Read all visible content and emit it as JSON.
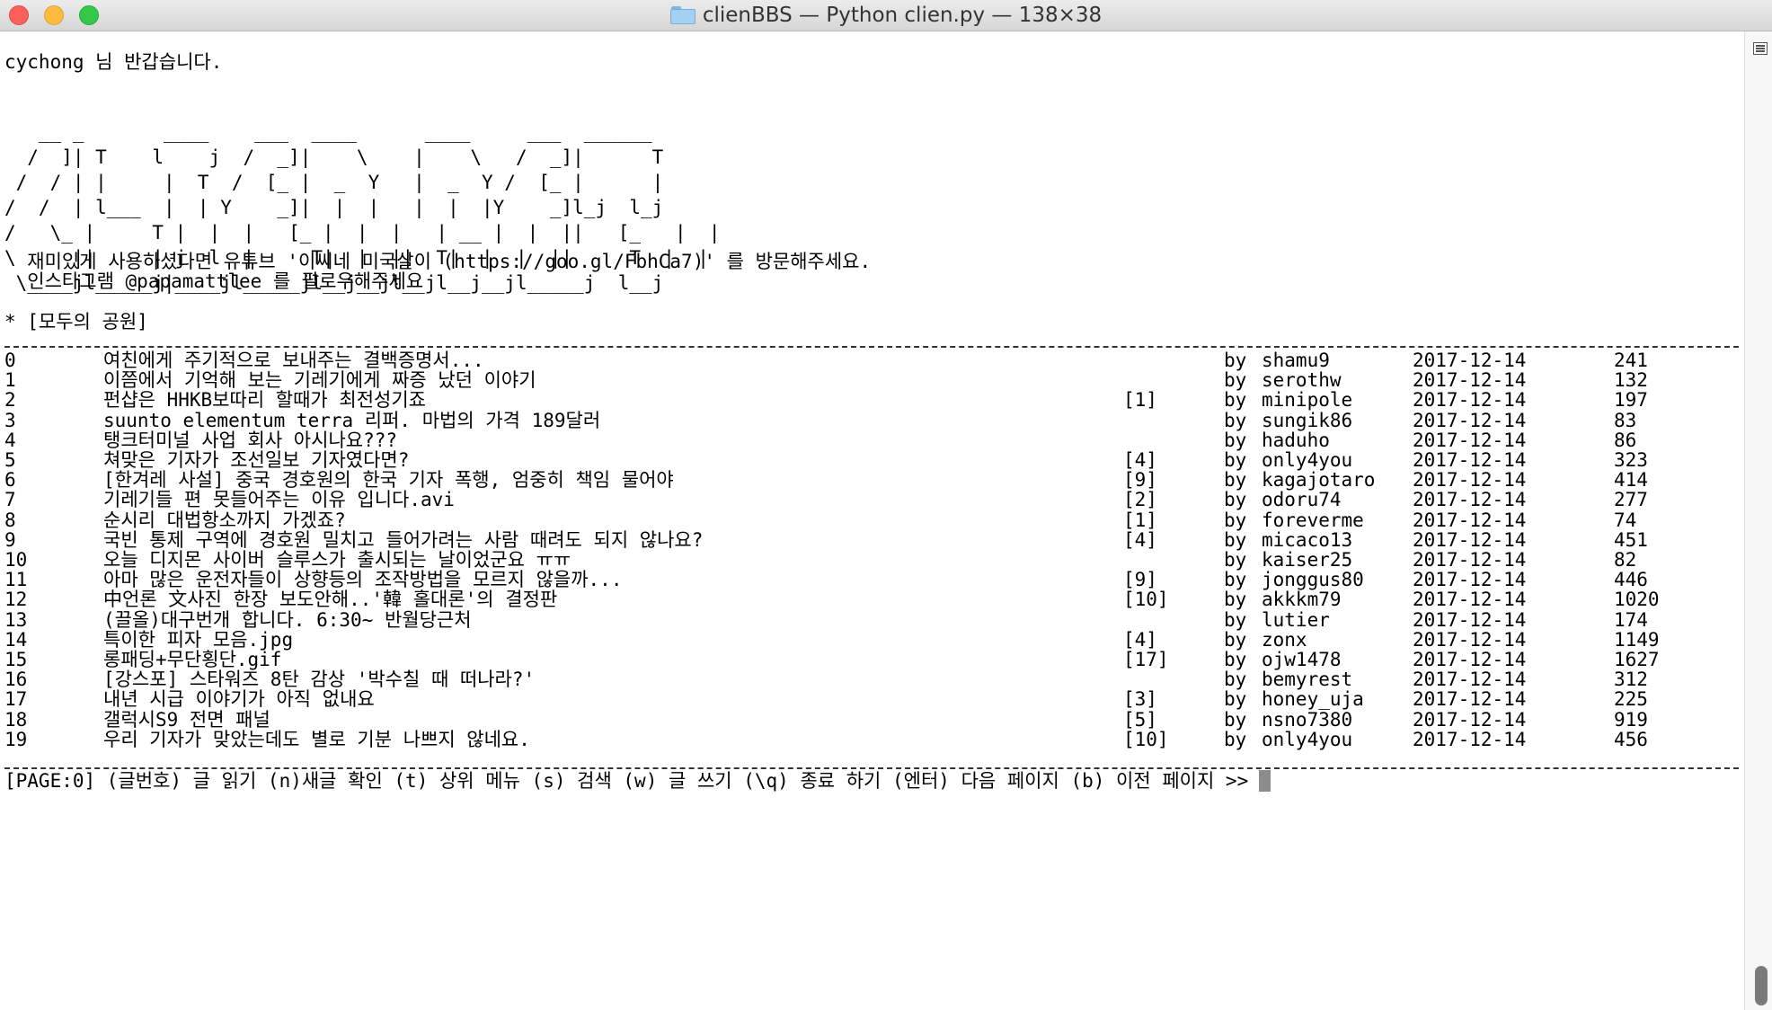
{
  "window": {
    "title": "clienBBS — Python clien.py — 138×38",
    "folder_icon": "folder-icon"
  },
  "greeting": "cychong 님 반갑습니다.",
  "ascii_art": "   __ _       ____    ___  ____      ____     ___  ______ \n  /  ]| T    l    j  /  _]|    \\    |    \\   /  _]|      T\n /  / | |     |  T  /  [_ |  _  Y   |  _  Y /  [_ |      |\n/  /  | l___  |  | Y    _]|  |  |   |  |  |Y    _]l_j  l_j\n/   \\_ |     T |  |  |   [_ |  |  |   | __ |  |  ||   [_   |  |  \n\\     ||     | j  l  |     T|  |  ||  T|  |  |  ||     T  |  |  \n \\____jl_____j|____jl_____jl__j__jl__jl__j__jl_____j  l__j",
  "promo": {
    "line1": "  재미있게 사용하셨다면 유튜브 '이씨네 미국살이 (https://goo.gl/FbhCa7)' 를 방문해주세요.",
    "line2": "  인스타그램 @papamattlee 를 팔로우해주세요"
  },
  "board_name": "* [모두의 공원]",
  "posts": [
    {
      "num": "0",
      "title": "여친에게 주기적으로 보내주는 결백증명서...",
      "comments": "",
      "by": "by",
      "author": "shamu9",
      "date": "2017-12-14",
      "views": "241"
    },
    {
      "num": "1",
      "title": "이쯤에서 기억해 보는 기레기에게 짜증 났던 이야기",
      "comments": "",
      "by": "by",
      "author": "serothw",
      "date": "2017-12-14",
      "views": "132"
    },
    {
      "num": "2",
      "title": "펀샵은 HHKB보따리 할때가 최전성기죠",
      "comments": "[1]",
      "by": "by",
      "author": "minipole",
      "date": "2017-12-14",
      "views": "197"
    },
    {
      "num": "3",
      "title": "suunto elementum terra 리퍼. 마법의 가격 189달러",
      "comments": "",
      "by": "by",
      "author": "sungik86",
      "date": "2017-12-14",
      "views": "83"
    },
    {
      "num": "4",
      "title": "탱크터미널 사업 회사 아시나요???",
      "comments": "",
      "by": "by",
      "author": "haduho",
      "date": "2017-12-14",
      "views": "86"
    },
    {
      "num": "5",
      "title": "쳐맞은 기자가 조선일보 기자였다면?",
      "comments": "[4]",
      "by": "by",
      "author": "only4you",
      "date": "2017-12-14",
      "views": "323"
    },
    {
      "num": "6",
      "title": "[한겨레 사설] 중국 경호원의 한국 기자 폭행, 엄중히 책임 물어야",
      "comments": "[9]",
      "by": "by",
      "author": "kagajotaro",
      "date": "2017-12-14",
      "views": "414"
    },
    {
      "num": "7",
      "title": "기레기들 편 못들어주는 이유 입니다.avi",
      "comments": "[2]",
      "by": "by",
      "author": "odoru74",
      "date": "2017-12-14",
      "views": "277"
    },
    {
      "num": "8",
      "title": "순시리 대법항소까지 가겠죠?",
      "comments": "[1]",
      "by": "by",
      "author": "foreverme",
      "date": "2017-12-14",
      "views": "74"
    },
    {
      "num": "9",
      "title": "국빈 통제 구역에 경호원 밀치고 들어가려는 사람 때려도 되지 않나요?",
      "comments": "[4]",
      "by": "by",
      "author": "micaco13",
      "date": "2017-12-14",
      "views": "451"
    },
    {
      "num": "10",
      "title": "오늘 디지몬 사이버 슬루스가 출시되는 날이었군요 ㅠㅠ",
      "comments": "",
      "by": "by",
      "author": "kaiser25",
      "date": "2017-12-14",
      "views": "82"
    },
    {
      "num": "11",
      "title": "아마 많은 운전자들이 상향등의 조작방법을 모르지 않을까...",
      "comments": "[9]",
      "by": "by",
      "author": "jonggus80",
      "date": "2017-12-14",
      "views": "446"
    },
    {
      "num": "12",
      "title": "中언론 文사진 한장 보도안해..'韓 홀대론'의 결정판",
      "comments": "[10]",
      "by": "by",
      "author": "akkkm79",
      "date": "2017-12-14",
      "views": "1020"
    },
    {
      "num": "13",
      "title": "(끌올)대구번개 합니다. 6:30~ 반월당근처",
      "comments": "",
      "by": "by",
      "author": "lutier",
      "date": "2017-12-14",
      "views": "174"
    },
    {
      "num": "14",
      "title": "특이한 피자 모음.jpg",
      "comments": "[4]",
      "by": "by",
      "author": "zonx",
      "date": "2017-12-14",
      "views": "1149"
    },
    {
      "num": "15",
      "title": "롱패딩+무단횡단.gif",
      "comments": "[17]",
      "by": "by",
      "author": "ojw1478",
      "date": "2017-12-14",
      "views": "1627"
    },
    {
      "num": "16",
      "title": "[강스포] 스타워즈 8탄 감상 '박수칠 때 떠나라?'",
      "comments": "",
      "by": "by",
      "author": "bemyrest",
      "date": "2017-12-14",
      "views": "312"
    },
    {
      "num": "17",
      "title": "내년 시급 이야기가 아직 없내요",
      "comments": "[3]",
      "by": "by",
      "author": "honey_uja",
      "date": "2017-12-14",
      "views": "225"
    },
    {
      "num": "18",
      "title": "갤럭시S9 전면 패널",
      "comments": "[5]",
      "by": "by",
      "author": "nsno7380",
      "date": "2017-12-14",
      "views": "919"
    },
    {
      "num": "19",
      "title": "우리 기자가 맞았는데도 별로 기분 나쁘지 않네요.",
      "comments": "[10]",
      "by": "by",
      "author": "only4you",
      "date": "2017-12-14",
      "views": "456"
    }
  ],
  "prompt": "[PAGE:0] (글번호) 글 읽기 (n)새글 확인 (t) 상위 메뉴 (s) 검색 (w) 글 쓰기 (\\q) 종료 하기 (엔터) 다음 페이지 (b) 이전 페이지 >>",
  "icons": {
    "window_close": "close-icon",
    "window_minimize": "minimize-icon",
    "window_zoom": "zoom-icon",
    "scroll_menu": "menu-lines-icon"
  },
  "colors": {
    "close": "#fc605c",
    "minimize": "#fdbc40",
    "zoom": "#34c84a",
    "text": "#000000",
    "background": "#ffffff"
  }
}
